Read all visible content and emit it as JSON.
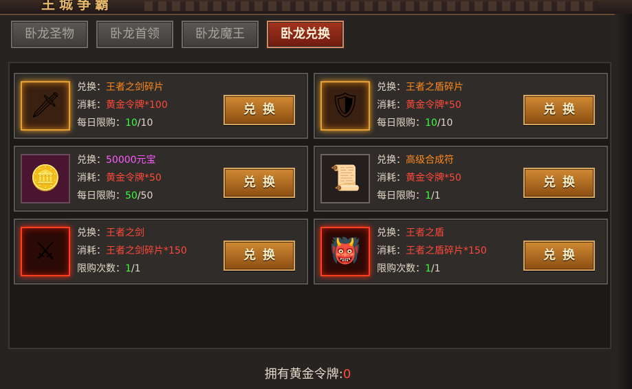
{
  "window": {
    "title": "王城争霸"
  },
  "tabs": [
    {
      "label": "卧龙圣物",
      "active": false
    },
    {
      "label": "卧龙首领",
      "active": false
    },
    {
      "label": "卧龙魔王",
      "active": false
    },
    {
      "label": "卧龙兑换",
      "active": true
    }
  ],
  "cards": [
    {
      "icon": "sword-shard-icon",
      "icon_glyph": "🗡",
      "exchange_label": "兑换：",
      "exchange_item": "王者之剑碎片",
      "cost_label": "消耗：",
      "cost_value": "黄金令牌*100",
      "limit_label": "每日限购：",
      "limit_used": "10",
      "limit_total": "/10",
      "button": "兑换"
    },
    {
      "icon": "shield-shard-icon",
      "icon_glyph": "🛡",
      "exchange_label": "兑换：",
      "exchange_item": "王者之盾碎片",
      "cost_label": "消耗：",
      "cost_value": "黄金令牌*50",
      "limit_label": "每日限购：",
      "limit_used": "10",
      "limit_total": "/10",
      "button": "兑换"
    },
    {
      "icon": "gold-ingot-icon",
      "icon_glyph": "🪙",
      "exchange_label": "兑换：",
      "exchange_item": "50000元宝",
      "cost_label": "消耗：",
      "cost_value": "黄金令牌*50",
      "limit_label": "每日限购：",
      "limit_used": "50",
      "limit_total": "/50",
      "button": "兑换"
    },
    {
      "icon": "scroll-icon",
      "icon_glyph": "📜",
      "exchange_label": "兑换：",
      "exchange_item": "高级合成符",
      "cost_label": "消耗：",
      "cost_value": "黄金令牌*50",
      "limit_label": "每日限购：",
      "limit_used": "1",
      "limit_total": "/1",
      "button": "兑换"
    },
    {
      "icon": "kings-sword-icon",
      "icon_glyph": "⚔",
      "exchange_label": "兑换：",
      "exchange_item": "王者之剑",
      "cost_label": "消耗：",
      "cost_value": "王者之剑碎片*150",
      "limit_label": "限购次数：",
      "limit_used": "1",
      "limit_total": "/1",
      "button": "兑换"
    },
    {
      "icon": "kings-shield-icon",
      "icon_glyph": "👹",
      "exchange_label": "兑换：",
      "exchange_item": "王者之盾",
      "cost_label": "消耗：",
      "cost_value": "王者之盾碎片*150",
      "limit_label": "限购次数：",
      "limit_used": "1",
      "limit_total": "/1",
      "button": "兑换"
    }
  ],
  "footer": {
    "label": "拥有黄金令牌:",
    "count": "0"
  },
  "colors": {
    "accent_red": "#a3341d",
    "gold_button": "#d18a33",
    "green": "#3bff3b",
    "orange": "#ff8a1a"
  }
}
